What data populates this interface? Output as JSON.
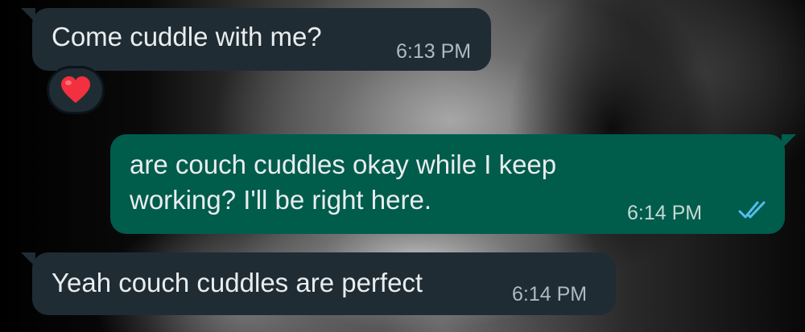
{
  "messages": [
    {
      "direction": "incoming",
      "text": "Come cuddle with me?",
      "time": "6:13 PM",
      "reaction": "heart-emoji"
    },
    {
      "direction": "outgoing",
      "lines": [
        "are couch cuddles okay while I keep",
        "working? I'll be right here."
      ],
      "time": "6:14 PM",
      "status": "read-double-check-icon"
    },
    {
      "direction": "incoming",
      "text": "Yeah couch cuddles are perfect",
      "time": "6:14 PM"
    }
  ],
  "colors": {
    "incoming_bubble": "#202c33",
    "outgoing_bubble": "#005c4b",
    "text": "#e9edef",
    "read_check": "#53bdeb"
  }
}
